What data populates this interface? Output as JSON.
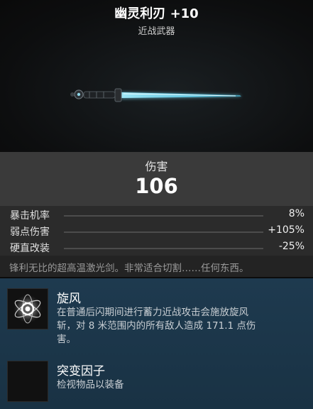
{
  "item": {
    "title": "幽灵利刃 +10",
    "category": "近战武器"
  },
  "damage": {
    "label": "伤害",
    "value": "106"
  },
  "stats": [
    {
      "name": "暴击机率",
      "value": "8%"
    },
    {
      "name": "弱点伤害",
      "value": "+105%"
    },
    {
      "name": "硬直改装",
      "value": "-25%"
    }
  ],
  "description": "锋利无比的超高温激光剑。非常适合切割……任何东西。",
  "mods": [
    {
      "name": "旋风",
      "desc_line1": "在普通后闪期间进行蓄力近战攻击会施放旋风",
      "desc_line2": "斩，对 8 米范围内的所有敌人造成 171.1 点伤",
      "desc_line3": "害。",
      "icon": "whirlwind-icon"
    },
    {
      "name": "突变因子",
      "desc_line1": "检视物品以装备",
      "icon": "empty-slot-icon"
    }
  ],
  "colors": {
    "blade_glow": "#7fd9ef",
    "mods_bg": "#1e3a4f",
    "damage_bg": "#3a3a3a"
  }
}
